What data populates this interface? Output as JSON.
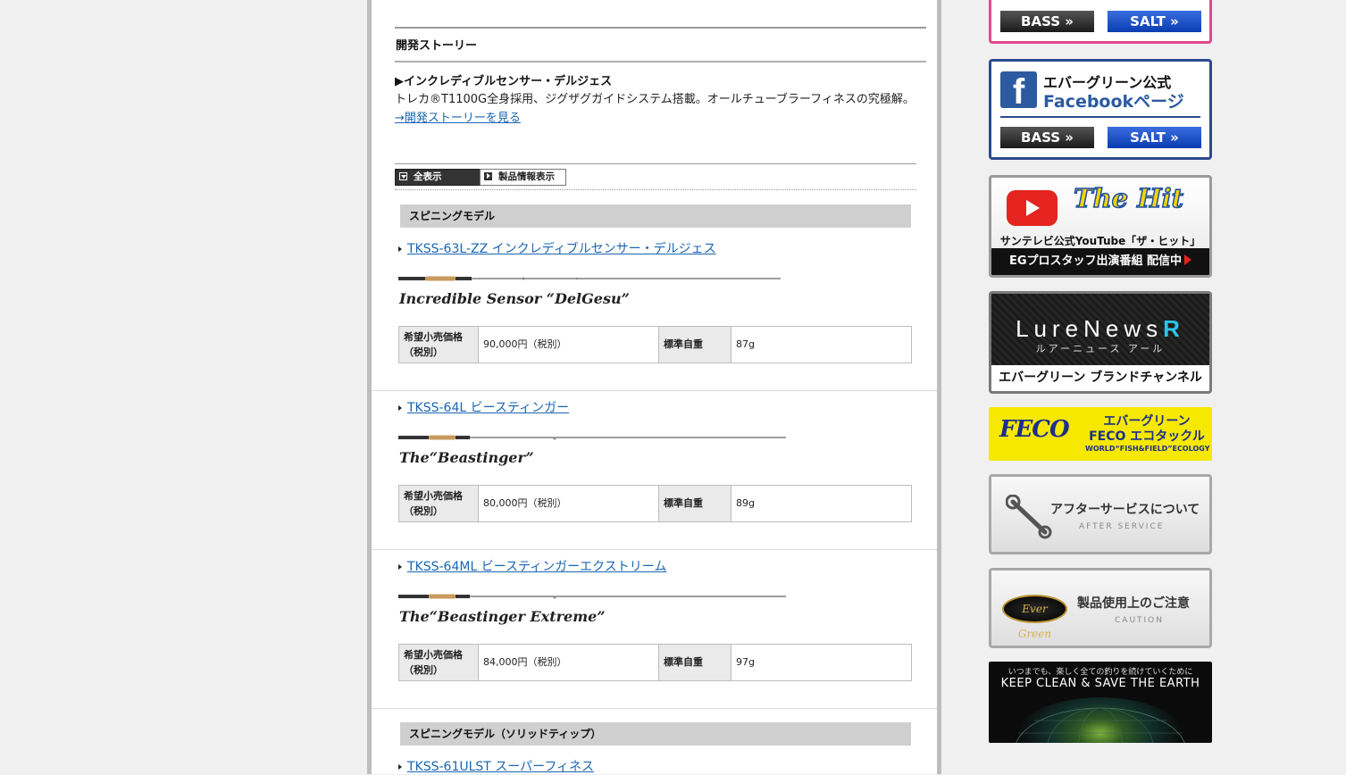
{
  "story": {
    "heading": "開発ストーリー",
    "title": "▶インクレディブルセンサー・デルジェス",
    "text": "トレカ®T1100G全身採用、ジグザグガイドシステム搭載。オールチューブラーフィネスの究極解。",
    "link": "→開発ストーリーを見る"
  },
  "toggle": {
    "all": "全表示",
    "info": "製品情報表示"
  },
  "categories": [
    "スピニングモデル",
    "スピニングモデル（ソリッドティップ）"
  ],
  "spec_labels": {
    "price": "希望小売価格（税別）",
    "price_l1": "希望小売価格",
    "price_l2": "（税別）",
    "weight": "標準自重"
  },
  "products": [
    {
      "link": "TKSS-63L-ZZ インクレディブルセンサー・デルジェス",
      "rod_name": "Incredible Sensor “DelGesu”",
      "price": "90,000円（税別）",
      "weight": "87g"
    },
    {
      "link": "TKSS-64L ビースティンガー",
      "rod_name": "The“Beastinger”",
      "price": "80,000円（税別）",
      "weight": "89g"
    },
    {
      "link": "TKSS-64ML ビースティンガーエクストリーム",
      "rod_name": "The“Beastinger Extreme”",
      "price": "84,000円（税別）",
      "weight": "97g"
    },
    {
      "link": "TKSS-61ULST スーパーフィネス"
    }
  ],
  "sidebar": {
    "social_top": {
      "bass": "BASS »",
      "salt": "SALT »"
    },
    "facebook": {
      "title1": "エバーグリーン公式",
      "title2": "Facebookページ",
      "bass": "BASS »",
      "salt": "SALT »"
    },
    "youtube": {
      "logo_text": "The Hit",
      "line1": "サンテレビ公式YouTube「ザ・ヒット」",
      "line2": "EGプロスタッフ出演番組 配信中"
    },
    "lurenews": {
      "title": "LureNews",
      "title_r": "R",
      "kana": "ルアーニュース アール",
      "sub": "エバーグリーン ブランドチャンネル"
    },
    "feco": {
      "logo": "FECO",
      "line1": "エバーグリーン",
      "line2": "FECO エコタックル",
      "line3": "WORLD“FISH&FIELD”ECOLOGY"
    },
    "service": {
      "main": "アフターサービスについて",
      "sub": "AFTER SERVICE"
    },
    "caution": {
      "main": "製品使用上のご注意",
      "sub": "CAUTION",
      "logo": "Ever Green"
    },
    "earth": {
      "line1": "いつまでも、楽しく全ての釣りを続けていくために",
      "line2": "KEEP CLEAN & SAVE THE EARTH"
    }
  },
  "colors": {
    "link": "#1b65b1",
    "pink_border": "#e0498d",
    "fb_blue": "#2c4b8e",
    "salt_blue": "#0a3db0",
    "youtube_red": "#e52420",
    "feco_yellow": "#f6e800"
  }
}
